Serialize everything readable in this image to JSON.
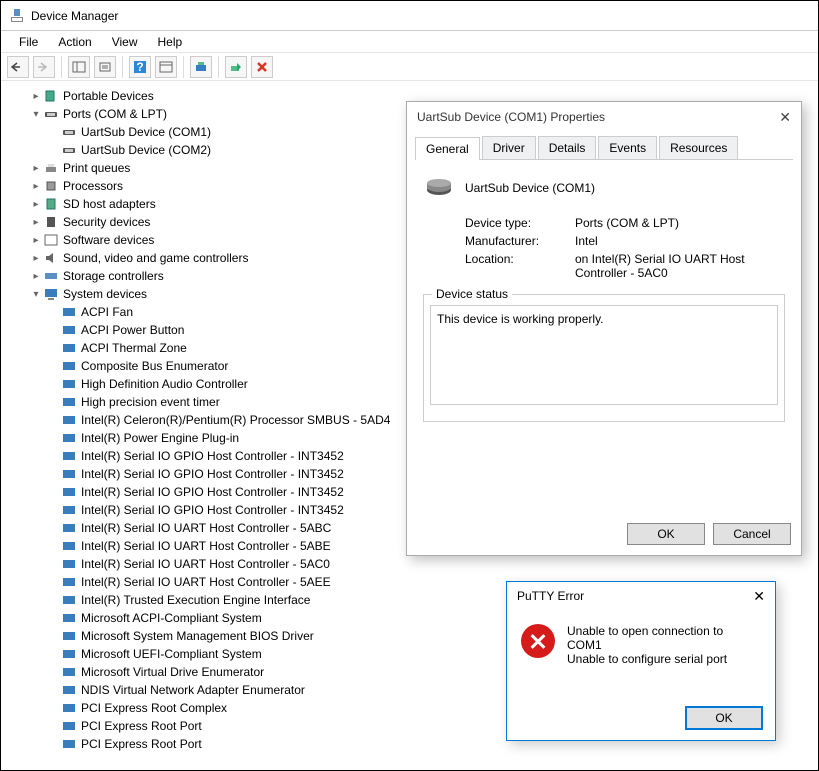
{
  "window": {
    "title": "Device Manager"
  },
  "menu": {
    "file": "File",
    "action": "Action",
    "view": "View",
    "help": "Help"
  },
  "tree": {
    "portable_devices": "Portable Devices",
    "ports": "Ports (COM & LPT)",
    "uart_com1": "UartSub Device (COM1)",
    "uart_com2": "UartSub Device (COM2)",
    "print_queues": "Print queues",
    "processors": "Processors",
    "sd_host": "SD host adapters",
    "security": "Security devices",
    "software": "Software devices",
    "sound": "Sound, video and game controllers",
    "storage": "Storage controllers",
    "system_devices": "System devices",
    "sd": {
      "acpi_fan": "ACPI Fan",
      "acpi_power": "ACPI Power Button",
      "acpi_thermal": "ACPI Thermal Zone",
      "composite": "Composite Bus Enumerator",
      "hd_audio": "High Definition Audio Controller",
      "hpet": "High precision event timer",
      "smbus": "Intel(R) Celeron(R)/Pentium(R) Processor SMBUS - 5AD4",
      "power_engine": "Intel(R) Power Engine Plug-in",
      "gpio1": "Intel(R) Serial IO GPIO Host Controller - INT3452",
      "gpio2": "Intel(R) Serial IO GPIO Host Controller - INT3452",
      "gpio3": "Intel(R) Serial IO GPIO Host Controller - INT3452",
      "gpio4": "Intel(R) Serial IO GPIO Host Controller - INT3452",
      "uart_5abc": "Intel(R) Serial IO UART Host Controller - 5ABC",
      "uart_5abe": "Intel(R) Serial IO UART Host Controller - 5ABE",
      "uart_5ac0": "Intel(R) Serial IO UART Host Controller - 5AC0",
      "uart_5aee": "Intel(R) Serial IO UART Host Controller - 5AEE",
      "txe": "Intel(R) Trusted Execution Engine Interface",
      "acpi_compliant": "Microsoft ACPI-Compliant System",
      "smbios": "Microsoft System Management BIOS Driver",
      "uefi": "Microsoft UEFI-Compliant System",
      "vdrive": "Microsoft Virtual Drive Enumerator",
      "ndis": "NDIS Virtual Network Adapter Enumerator",
      "pci_root_complex": "PCI Express Root Complex",
      "pci_root_port1": "PCI Express Root Port",
      "pci_root_port2": "PCI Express Root Port"
    }
  },
  "props": {
    "title": "UartSub Device (COM1) Properties",
    "tabs": {
      "general": "General",
      "driver": "Driver",
      "details": "Details",
      "events": "Events",
      "resources": "Resources"
    },
    "device_name": "UartSub Device (COM1)",
    "labels": {
      "device_type": "Device type:",
      "manufacturer": "Manufacturer:",
      "location": "Location:"
    },
    "values": {
      "device_type": "Ports (COM & LPT)",
      "manufacturer": "Intel",
      "location": "on Intel(R) Serial IO UART Host Controller - 5AC0"
    },
    "status_legend": "Device status",
    "status_text": "This device is working properly.",
    "ok": "OK",
    "cancel": "Cancel"
  },
  "putty": {
    "title": "PuTTY Error",
    "line1": "Unable to open connection to COM1",
    "line2": "Unable to configure serial port",
    "ok": "OK"
  }
}
